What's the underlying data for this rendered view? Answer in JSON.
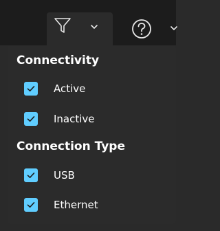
{
  "toolbar": {
    "filter_icon": "filter-funnel-icon",
    "help_icon": "help-circle-icon",
    "chevron_icon": "chevron-down-icon"
  },
  "filter_panel": {
    "sections": [
      {
        "title": "Connectivity",
        "items": [
          {
            "label": "Active",
            "checked": true
          },
          {
            "label": "Inactive",
            "checked": true
          }
        ]
      },
      {
        "title": "Connection Type",
        "items": [
          {
            "label": "USB",
            "checked": true
          },
          {
            "label": "Ethernet",
            "checked": true
          }
        ]
      }
    ]
  },
  "colors": {
    "accent": "#60cdff",
    "panel_bg": "#2b2b2b",
    "toolbar_bg": "#1c1c1c",
    "text": "#ffffff"
  }
}
